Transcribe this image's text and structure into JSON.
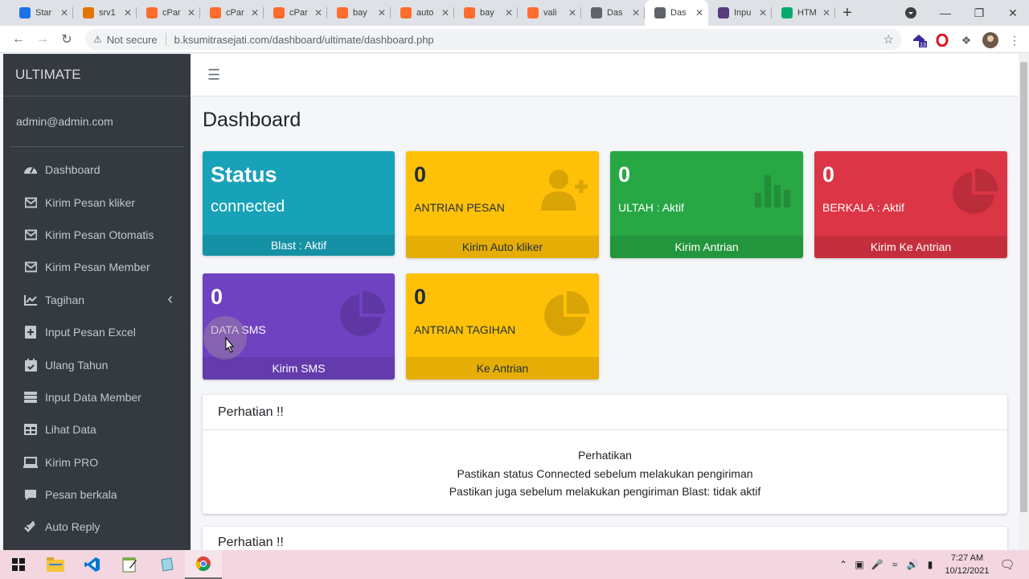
{
  "browser": {
    "tabs": [
      {
        "title": "Star",
        "favicon": "chart-favicon",
        "color": "#1a73e8",
        "active": false
      },
      {
        "title": "srv1",
        "favicon": "server-favicon",
        "color": "#e37400",
        "active": false
      },
      {
        "title": "cPar",
        "favicon": "cpanel-favicon",
        "color": "#ff6c2c",
        "active": false
      },
      {
        "title": "cPar",
        "favicon": "cpanel-favicon",
        "color": "#ff6c2c",
        "active": false
      },
      {
        "title": "cPar",
        "favicon": "cpanel-favicon",
        "color": "#ff6c2c",
        "active": false
      },
      {
        "title": "bay",
        "favicon": "cpanel-favicon",
        "color": "#ff6c2c",
        "active": false
      },
      {
        "title": "auto",
        "favicon": "cpanel-favicon",
        "color": "#ff6c2c",
        "active": false
      },
      {
        "title": "bay",
        "favicon": "cpanel-favicon",
        "color": "#ff6c2c",
        "active": false
      },
      {
        "title": "vali",
        "favicon": "cpanel-favicon",
        "color": "#ff6c2c",
        "active": false
      },
      {
        "title": "Das",
        "favicon": "globe-favicon",
        "color": "#5f6368",
        "active": false
      },
      {
        "title": "Das",
        "favicon": "globe-favicon",
        "color": "#5f6368",
        "active": true
      },
      {
        "title": "Inpu",
        "favicon": "bootstrap-favicon",
        "color": "#563d7c",
        "active": false
      },
      {
        "title": "HTM",
        "favicon": "w3schools-favicon",
        "color": "#04aa6d",
        "active": false
      }
    ],
    "security_label": "Not secure",
    "url": "b.ksumitrasejati.com/dashboard/ultimate/dashboard.php",
    "extension_badge": "13"
  },
  "sidebar": {
    "brand": "ULTIMATE",
    "user": "admin@admin.com",
    "items": [
      {
        "label": "Dashboard",
        "icon": "dashboard-gauge-icon"
      },
      {
        "label": "Kirim Pesan kliker",
        "icon": "envelope-icon"
      },
      {
        "label": "Kirim Pesan Otomatis",
        "icon": "envelope-icon"
      },
      {
        "label": "Kirim Pesan Member",
        "icon": "envelope-icon"
      },
      {
        "label": "Tagihan",
        "icon": "line-chart-icon",
        "has_submenu": true
      },
      {
        "label": "Input Pesan Excel",
        "icon": "file-plus-icon"
      },
      {
        "label": "Ulang Tahun",
        "icon": "calendar-check-icon"
      },
      {
        "label": "Input Data Member",
        "icon": "server-icon"
      },
      {
        "label": "Lihat Data",
        "icon": "table-icon"
      },
      {
        "label": "Kirim PRO",
        "icon": "laptop-icon"
      },
      {
        "label": "Pesan berkala",
        "icon": "comment-icon"
      },
      {
        "label": "Auto Reply",
        "icon": "check-double-icon"
      }
    ]
  },
  "main": {
    "page_title": "Dashboard",
    "boxes": [
      {
        "value": "Status",
        "label": "connected",
        "footer": "Blast : Aktif",
        "bg": "#17a2b8",
        "fg": "#ffffff",
        "icon": ""
      },
      {
        "value": "0",
        "label": "ANTRIAN PESAN",
        "footer": "Kirim Auto kliker",
        "bg": "#ffc107",
        "fg": "#1f2d3d",
        "icon": "user-plus-icon"
      },
      {
        "value": "0",
        "label": "ULTAH : Aktif",
        "footer": "Kirim Antrian",
        "bg": "#28a745",
        "fg": "#ffffff",
        "icon": "bar-chart-icon"
      },
      {
        "value": "0",
        "label": "BERKALA : Aktif",
        "footer": "Kirim Ke Antrian",
        "bg": "#dc3545",
        "fg": "#ffffff",
        "icon": "pie-chart-icon"
      },
      {
        "value": "0",
        "label": "DATA SMS",
        "footer": "Kirim SMS",
        "bg": "#6f42c1",
        "fg": "#ffffff",
        "icon": "pie-chart-icon"
      },
      {
        "value": "0",
        "label": "ANTRIAN TAGIHAN",
        "footer": "Ke Antrian",
        "bg": "#ffc107",
        "fg": "#1f2d3d",
        "icon": "pie-chart-icon"
      }
    ],
    "card1": {
      "header": "Perhatian !!",
      "lines": [
        "Perhatikan",
        "Pastikan status Connected sebelum melakukan pengiriman",
        "Pastikan juga sebelum melakukan pengiriman Blast: tidak aktif"
      ]
    },
    "card2": {
      "header": "Perhatian !!"
    }
  },
  "taskbar": {
    "apps": [
      "start-windows-icon",
      "file-explorer-icon",
      "vscode-icon",
      "notepad-icon",
      "app-icon",
      "chrome-icon"
    ],
    "time": "7:27 AM",
    "date": "10/12/2021"
  }
}
